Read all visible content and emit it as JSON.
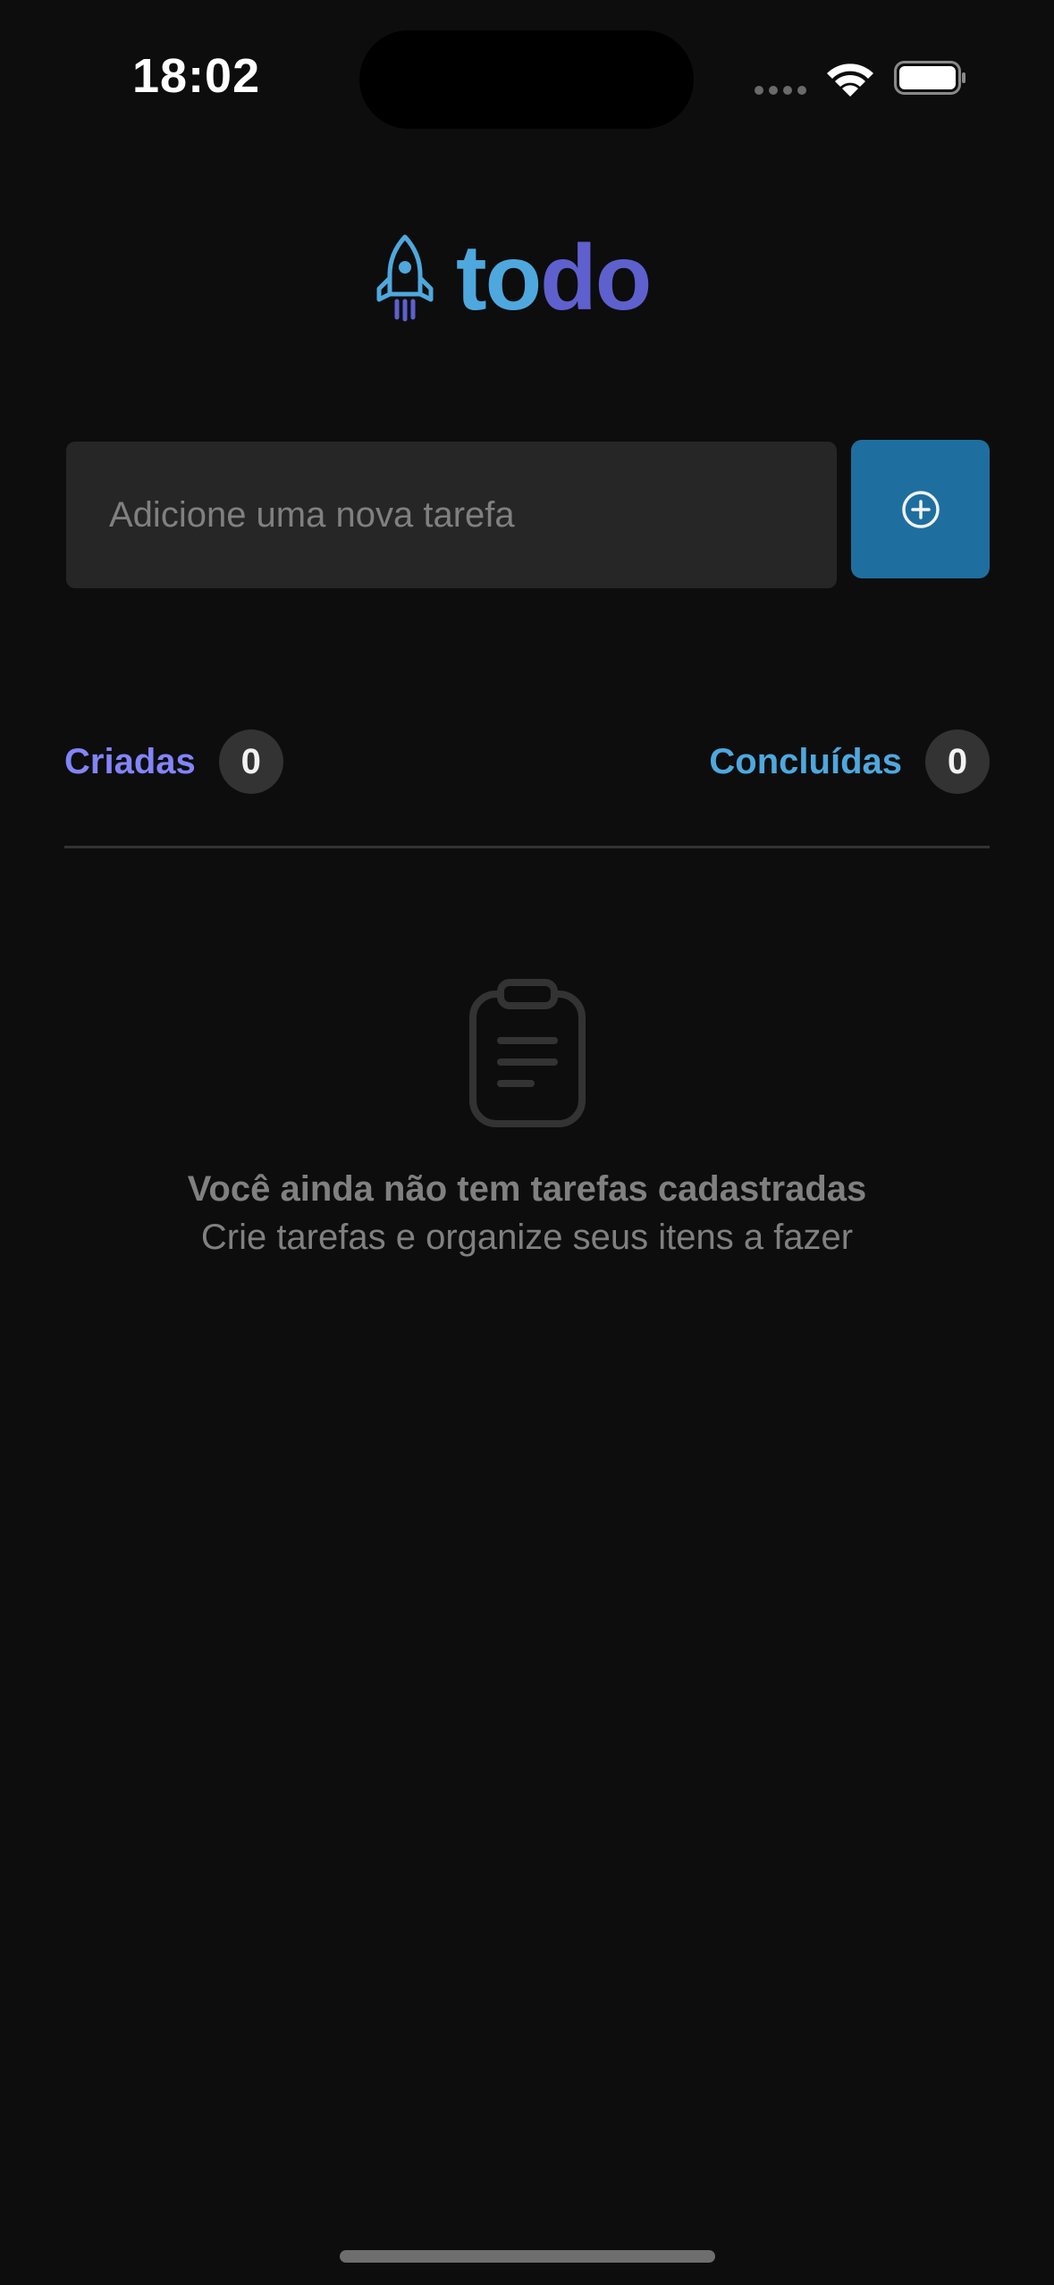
{
  "status_bar": {
    "time": "18:02"
  },
  "logo": {
    "text_part1": "to",
    "text_part2": "do",
    "icon": "rocket-icon"
  },
  "new_task": {
    "placeholder": "Adicione uma nova tarefa",
    "value": "",
    "button_icon": "plus-circle-icon"
  },
  "counters": {
    "created_label": "Criadas",
    "created_count": "0",
    "done_label": "Concluídas",
    "done_count": "0"
  },
  "empty_state": {
    "icon": "clipboard-icon",
    "title": "Você ainda não tem tarefas cadastradas",
    "subtitle": "Crie tarefas e organize seus itens a fazer"
  },
  "colors": {
    "background": "#0d0d0d",
    "blue": "#4ea8de",
    "purple": "#5e60ce",
    "purple_light": "#8284fa",
    "button": "#1e6f9f",
    "input_bg": "#262626",
    "badge_bg": "#333333",
    "muted_text": "#808080"
  }
}
